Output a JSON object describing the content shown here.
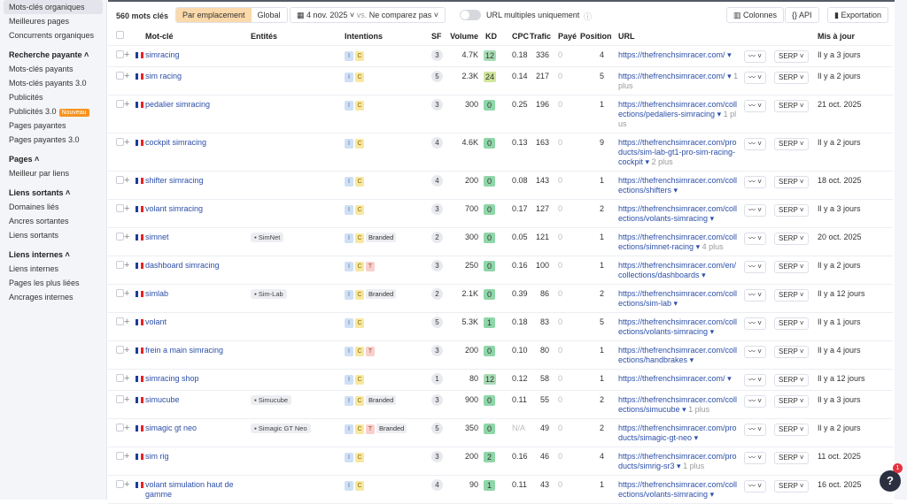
{
  "sidebar": {
    "items": [
      {
        "label": "Mots-clés organiques",
        "type": "item",
        "active": true
      },
      {
        "label": "Meilleures pages",
        "type": "item"
      },
      {
        "label": "Concurrents organiques",
        "type": "item"
      },
      {
        "label": "Recherche payante ˄",
        "type": "head"
      },
      {
        "label": "Mots-clés payants",
        "type": "item"
      },
      {
        "label": "Mots-clés payants 3.0",
        "type": "item"
      },
      {
        "label": "Publicités",
        "type": "item"
      },
      {
        "label": "Publicités 3.0",
        "type": "item",
        "badge": "Nouveau"
      },
      {
        "label": "Pages payantes",
        "type": "item"
      },
      {
        "label": "Pages payantes 3.0",
        "type": "item"
      },
      {
        "label": "Pages ˄",
        "type": "head"
      },
      {
        "label": "Meilleur par liens",
        "type": "item"
      },
      {
        "label": "Liens sortants ˄",
        "type": "head"
      },
      {
        "label": "Domaines liés",
        "type": "item"
      },
      {
        "label": "Ancres sortantes",
        "type": "item"
      },
      {
        "label": "Liens sortants",
        "type": "item"
      },
      {
        "label": "Liens internes ˄",
        "type": "head"
      },
      {
        "label": "Liens internes",
        "type": "item"
      },
      {
        "label": "Pages les plus liées",
        "type": "item"
      },
      {
        "label": "Ancrages internes",
        "type": "item"
      }
    ]
  },
  "toolbar": {
    "count": "560 mots clés",
    "seg_location": "Par emplacement",
    "seg_global": "Global",
    "date": "4 nov. 2025 ˅",
    "vs": "vs.",
    "compare": "Ne comparez pas ˅",
    "multi_url": "URL multiples uniquement",
    "columns": "Colonnes",
    "api": "API",
    "export": "Exportation"
  },
  "columns": [
    "Mot-clé",
    "Entités",
    "Intentions",
    "SF",
    "Volume",
    "KD",
    "CPC",
    "Trafic",
    "Payé",
    "Position",
    "URL",
    "Mis à jour"
  ],
  "colors": {
    "kd_green": "#8fd6a8",
    "kd_yellowgreen": "#cfe69a",
    "accent": "#fbd9aa"
  },
  "rows": [
    {
      "kw": "simracing",
      "ent": "",
      "int": [
        "I",
        "C"
      ],
      "branded": "",
      "sf": "3",
      "vol": "4.7K",
      "kd": "12",
      "cpc": "0.18",
      "traffic": "336",
      "paid": "0",
      "pos": "4",
      "url": "https://thefrenchsimracer.com/",
      "more": "",
      "updated": "Il y a 3 jours"
    },
    {
      "kw": "sim racing",
      "ent": "",
      "int": [
        "I",
        "C"
      ],
      "branded": "",
      "sf": "5",
      "vol": "2.3K",
      "kd": "24",
      "cpc": "0.14",
      "traffic": "217",
      "paid": "0",
      "pos": "5",
      "url": "https://thefrenchsimracer.com/",
      "more": "1 plus",
      "updated": "Il y a 2 jours"
    },
    {
      "kw": "pedalier simracing",
      "ent": "",
      "int": [
        "I",
        "C"
      ],
      "branded": "",
      "sf": "3",
      "vol": "300",
      "kd": "0",
      "cpc": "0.25",
      "traffic": "196",
      "paid": "0",
      "pos": "1",
      "url": "https://thefrenchsimracer.com/collections/pedaliers-simracing",
      "more": "1 plus",
      "updated": "21 oct. 2025"
    },
    {
      "kw": "cockpit simracing",
      "ent": "",
      "int": [
        "I",
        "C"
      ],
      "branded": "",
      "sf": "4",
      "vol": "4.6K",
      "kd": "0",
      "cpc": "0.13",
      "traffic": "163",
      "paid": "0",
      "pos": "9",
      "url": "https://thefrenchsimracer.com/products/sim-lab-gt1-pro-sim-racing-cockpit",
      "more": "2 plus",
      "updated": "Il y a 2 jours"
    },
    {
      "kw": "shifter simracing",
      "ent": "",
      "int": [
        "I",
        "C"
      ],
      "branded": "",
      "sf": "4",
      "vol": "200",
      "kd": "0",
      "cpc": "0.08",
      "traffic": "143",
      "paid": "0",
      "pos": "1",
      "url": "https://thefrenchsimracer.com/collections/shifters",
      "more": "",
      "updated": "18 oct. 2025"
    },
    {
      "kw": "volant simracing",
      "ent": "",
      "int": [
        "I",
        "C"
      ],
      "branded": "",
      "sf": "3",
      "vol": "700",
      "kd": "0",
      "cpc": "0.17",
      "traffic": "127",
      "paid": "0",
      "pos": "2",
      "url": "https://thefrenchsimracer.com/collections/volants-simracing",
      "more": "",
      "updated": "Il y a 3 jours"
    },
    {
      "kw": "simnet",
      "ent": "SimNet",
      "int": [
        "I",
        "C"
      ],
      "branded": "Branded",
      "sf": "2",
      "vol": "300",
      "kd": "0",
      "cpc": "0.05",
      "traffic": "121",
      "paid": "0",
      "pos": "1",
      "url": "https://thefrenchsimracer.com/collections/simnet-racing",
      "more": "4 plus",
      "updated": "20 oct. 2025"
    },
    {
      "kw": "dashboard simracing",
      "ent": "",
      "int": [
        "I",
        "C",
        "T"
      ],
      "branded": "",
      "sf": "3",
      "vol": "250",
      "kd": "0",
      "cpc": "0.16",
      "traffic": "100",
      "paid": "0",
      "pos": "1",
      "url": "https://thefrenchsimracer.com/en/collections/dashboards",
      "more": "",
      "updated": "Il y a 2 jours"
    },
    {
      "kw": "simlab",
      "ent": "Sim-Lab",
      "int": [
        "I",
        "C"
      ],
      "branded": "Branded",
      "sf": "2",
      "vol": "2.1K",
      "kd": "0",
      "cpc": "0.39",
      "traffic": "86",
      "paid": "0",
      "pos": "2",
      "url": "https://thefrenchsimracer.com/collections/sim-lab",
      "more": "",
      "updated": "Il y a 12 jours"
    },
    {
      "kw": "volant",
      "ent": "",
      "int": [
        "I",
        "C"
      ],
      "branded": "",
      "sf": "5",
      "vol": "5.3K",
      "kd": "1",
      "cpc": "0.18",
      "traffic": "83",
      "paid": "0",
      "pos": "5",
      "url": "https://thefrenchsimracer.com/collections/volants-simracing",
      "more": "",
      "updated": "Il y a 1 jours"
    },
    {
      "kw": "frein a main simracing",
      "ent": "",
      "int": [
        "I",
        "C",
        "T"
      ],
      "branded": "",
      "sf": "3",
      "vol": "200",
      "kd": "0",
      "cpc": "0.10",
      "traffic": "80",
      "paid": "0",
      "pos": "1",
      "url": "https://thefrenchsimracer.com/collections/handbrakes",
      "more": "",
      "updated": "Il y a 4 jours"
    },
    {
      "kw": "simracing shop",
      "ent": "",
      "int": [
        "I",
        "C"
      ],
      "branded": "",
      "sf": "1",
      "vol": "80",
      "kd": "12",
      "cpc": "0.12",
      "traffic": "58",
      "paid": "0",
      "pos": "1",
      "url": "https://thefrenchsimracer.com/",
      "more": "",
      "updated": "Il y a 12 jours"
    },
    {
      "kw": "simucube",
      "ent": "Simucube",
      "int": [
        "I",
        "C"
      ],
      "branded": "Branded",
      "sf": "3",
      "vol": "900",
      "kd": "0",
      "cpc": "0.11",
      "traffic": "55",
      "paid": "0",
      "pos": "2",
      "url": "https://thefrenchsimracer.com/collections/simucube",
      "more": "1 plus",
      "updated": "Il y a 3 jours"
    },
    {
      "kw": "simagic gt neo",
      "ent": "Simagic GT Neo",
      "int": [
        "I",
        "C",
        "T"
      ],
      "branded": "Branded",
      "sf": "5",
      "vol": "350",
      "kd": "0",
      "cpc": "N/A",
      "traffic": "49",
      "paid": "0",
      "pos": "2",
      "url": "https://thefrenchsimracer.com/products/simagic-gt-neo",
      "more": "",
      "updated": "Il y a 2 jours"
    },
    {
      "kw": "sim rig",
      "ent": "",
      "int": [
        "I",
        "C"
      ],
      "branded": "",
      "sf": "3",
      "vol": "200",
      "kd": "2",
      "cpc": "0.16",
      "traffic": "46",
      "paid": "0",
      "pos": "4",
      "url": "https://thefrenchsimracer.com/products/simrig-sr3",
      "more": "1 plus",
      "updated": "11 oct. 2025"
    },
    {
      "kw": "volant simulation haut de gamme",
      "ent": "",
      "int": [
        "I",
        "C"
      ],
      "branded": "",
      "sf": "4",
      "vol": "90",
      "kd": "1",
      "cpc": "0.11",
      "traffic": "43",
      "paid": "0",
      "pos": "1",
      "url": "https://thefrenchsimracer.com/collections/volants-simracing",
      "more": "",
      "updated": "16 oct. 2025"
    }
  ],
  "row_buttons": {
    "trend": "〰 ˅",
    "serp": "SERP ˅"
  },
  "help": {
    "label": "?",
    "badge": "1"
  }
}
